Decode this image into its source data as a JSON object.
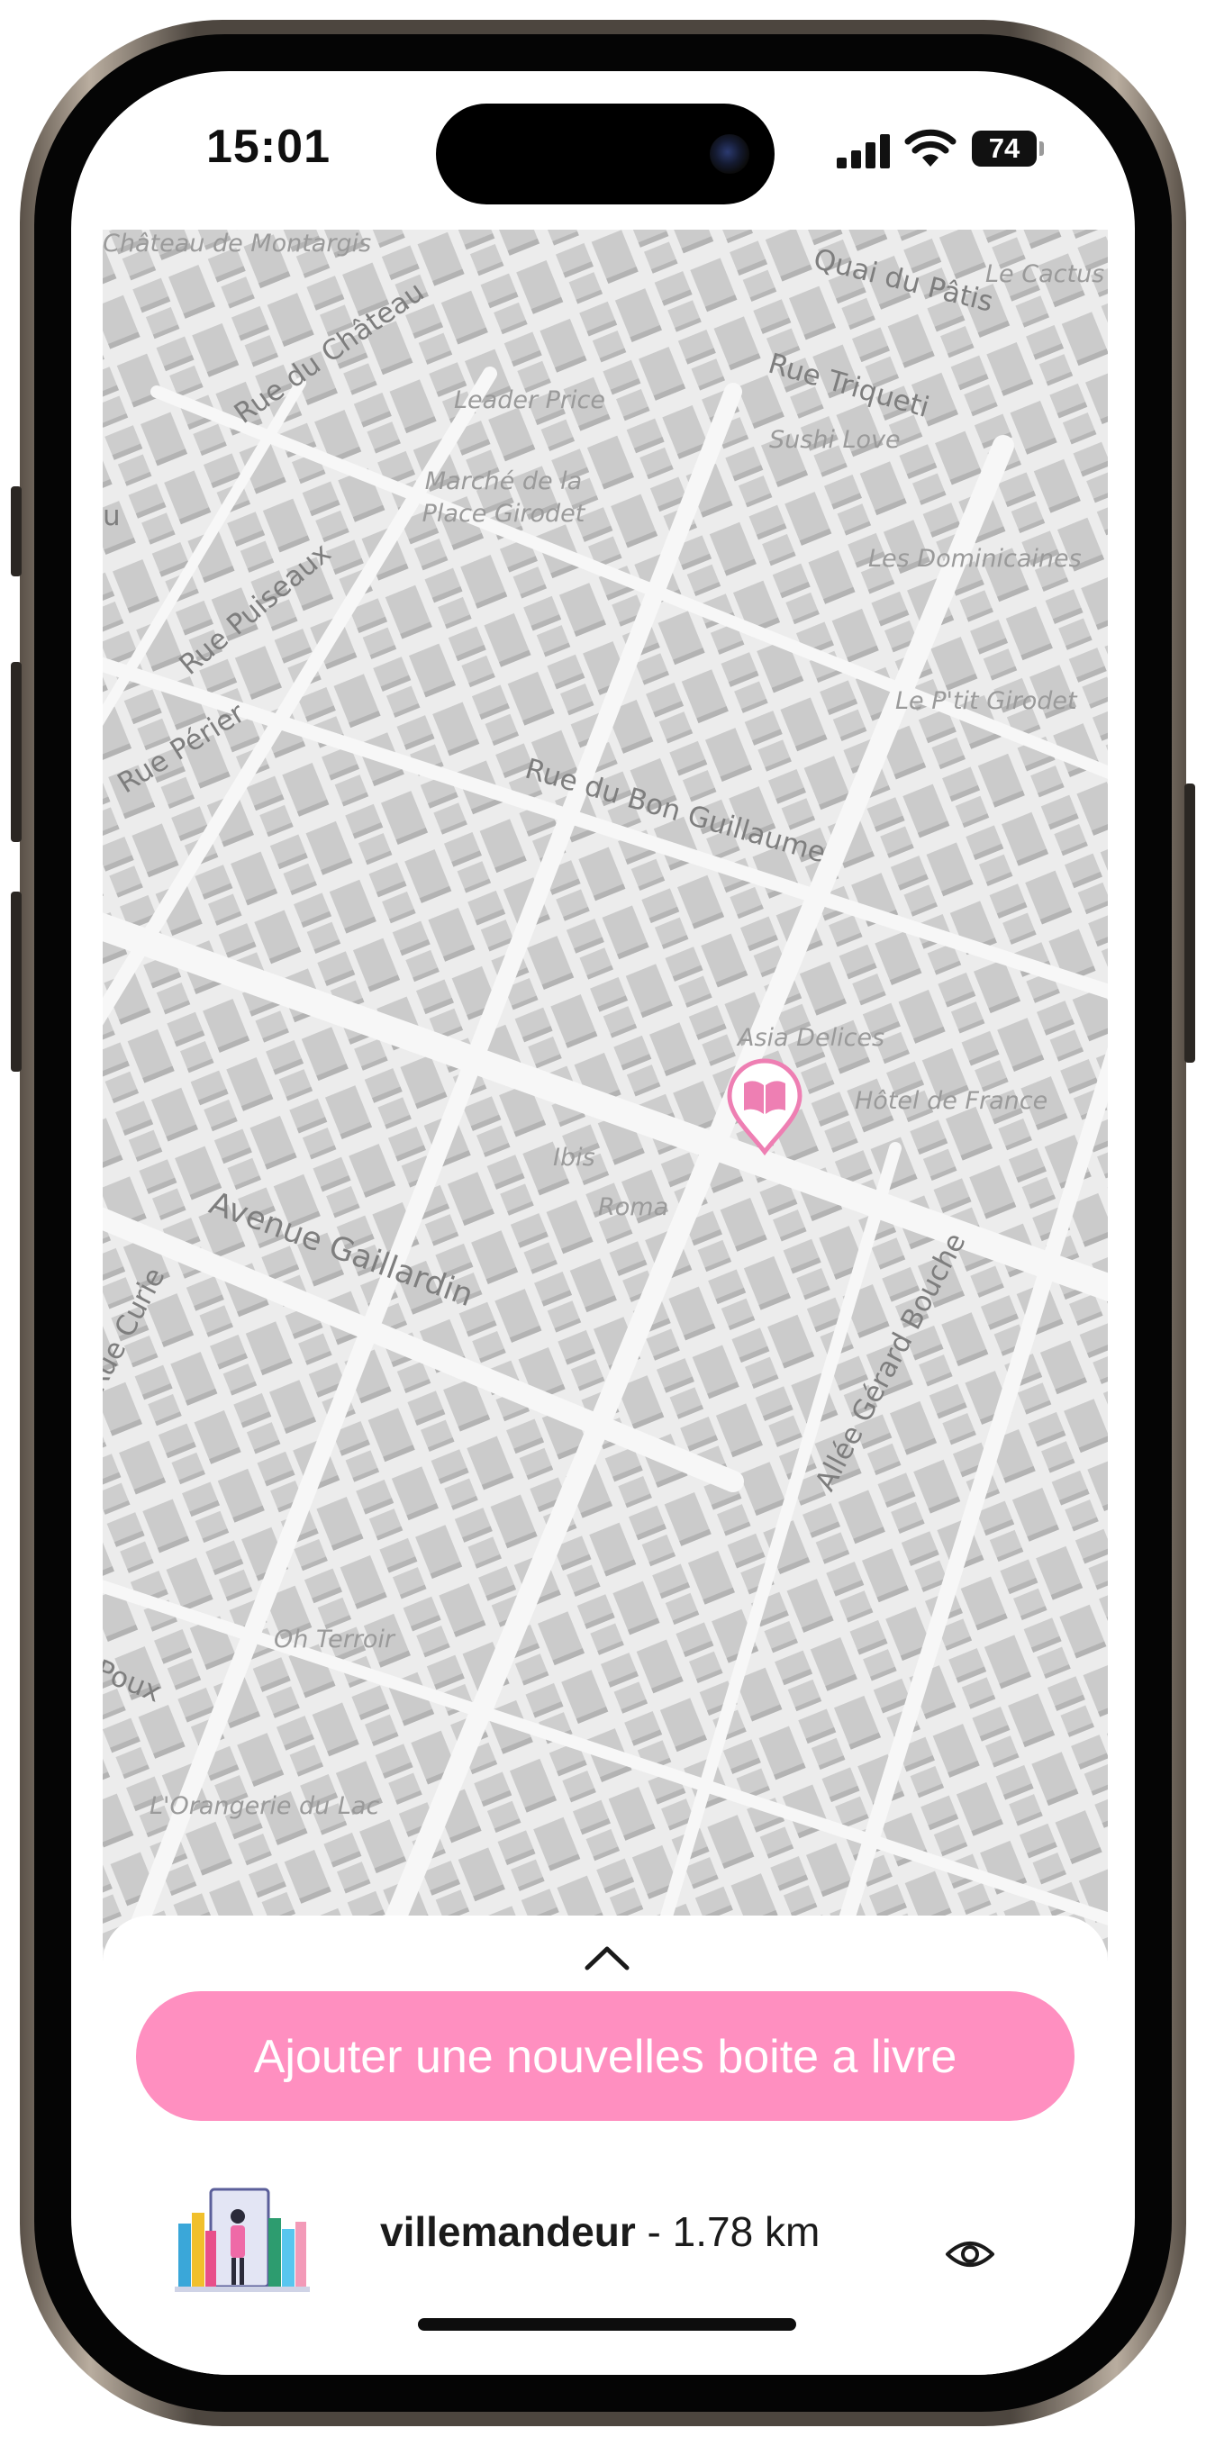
{
  "status_bar": {
    "time": "15:01",
    "battery": "74"
  },
  "map": {
    "street_labels": [
      "Rue du Château",
      "Quai du Pâtis",
      "Rue Triqueti",
      "Rue Périer",
      "Rue du Bon Guillaume",
      "Avenue Gaillardin",
      "Allée Gérard Bouche",
      "Rue Curie",
      "Rue Puiseaux",
      "Poux",
      "u"
    ],
    "poi_labels": [
      "Château de Montargis",
      "Le Cactus",
      "Leader Price",
      "Sushi Love",
      "Marché de la Place Girodet",
      "Les Dominicaines",
      "Le P'tit Girodet",
      "Asia Delices",
      "Hôtel de France",
      "Ibis",
      "Roma",
      "Oh Terroir",
      "L'Orangerie du Lac"
    ],
    "marker_icon": "book-map-pin-icon",
    "marker_color": "#ee7fb3"
  },
  "sheet": {
    "handle_icon": "chevron-up-icon",
    "add_button_label": "Ajouter une nouvelles boite a livre",
    "add_button_color": "#ff8fc0",
    "items": [
      {
        "name": "villemandeur",
        "separator": " - ",
        "distance": "1.78 km",
        "action_icon": "eye-icon"
      }
    ]
  }
}
